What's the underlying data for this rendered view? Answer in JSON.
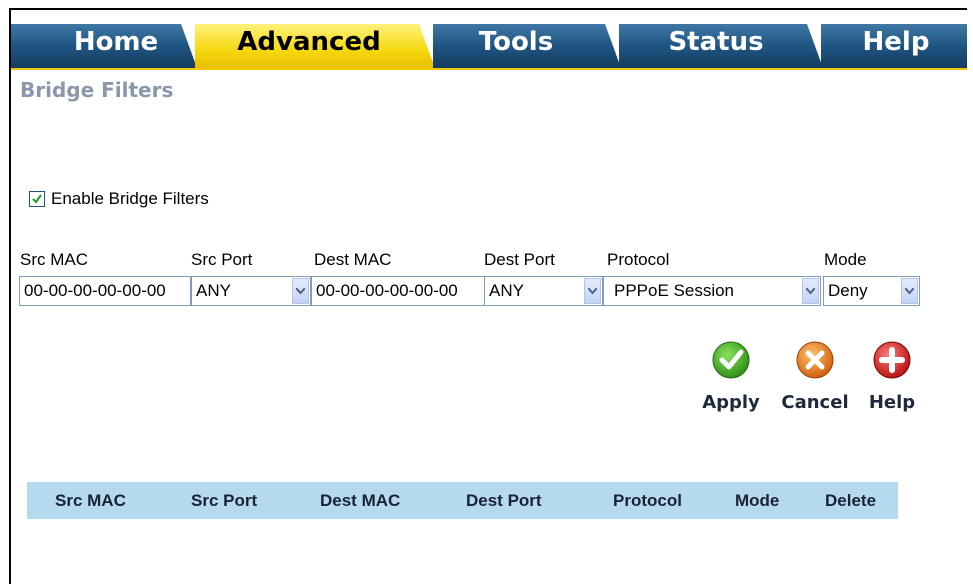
{
  "tabs": [
    {
      "label": "Home",
      "active": false
    },
    {
      "label": "Advanced",
      "active": true
    },
    {
      "label": "Tools",
      "active": false
    },
    {
      "label": "Status",
      "active": false
    },
    {
      "label": "Help",
      "active": false
    }
  ],
  "section_title": "Bridge Filters",
  "enable": {
    "label": "Enable Bridge Filters",
    "checked": true
  },
  "form": {
    "headers": {
      "src_mac": "Src MAC",
      "src_port": "Src Port",
      "dest_mac": "Dest MAC",
      "dest_port": "Dest Port",
      "protocol": "Protocol",
      "mode": "Mode"
    },
    "values": {
      "src_mac": "00-00-00-00-00-00",
      "src_port": "ANY",
      "dest_mac": "00-00-00-00-00-00",
      "dest_port": "ANY",
      "protocol": "PPPoE Session",
      "mode": "Deny"
    }
  },
  "actions": {
    "apply": "Apply",
    "cancel": "Cancel",
    "help": "Help"
  },
  "table": {
    "headers": [
      "Src MAC",
      "Src Port",
      "Dest MAC",
      "Dest Port",
      "Protocol",
      "Mode",
      "Delete"
    ]
  },
  "colors": {
    "tab_blue": "#1f4e79",
    "tab_active": "#f5d30a",
    "title_gray": "#8a96ab",
    "table_header_bg": "#b5daf0",
    "apply_green": "#3fa51f",
    "cancel_orange": "#e07a1a",
    "help_red": "#d11a1a"
  },
  "icons": {
    "apply": "check-icon",
    "cancel": "x-icon",
    "help": "plus-icon",
    "dropdown": "chevron-down-icon"
  }
}
